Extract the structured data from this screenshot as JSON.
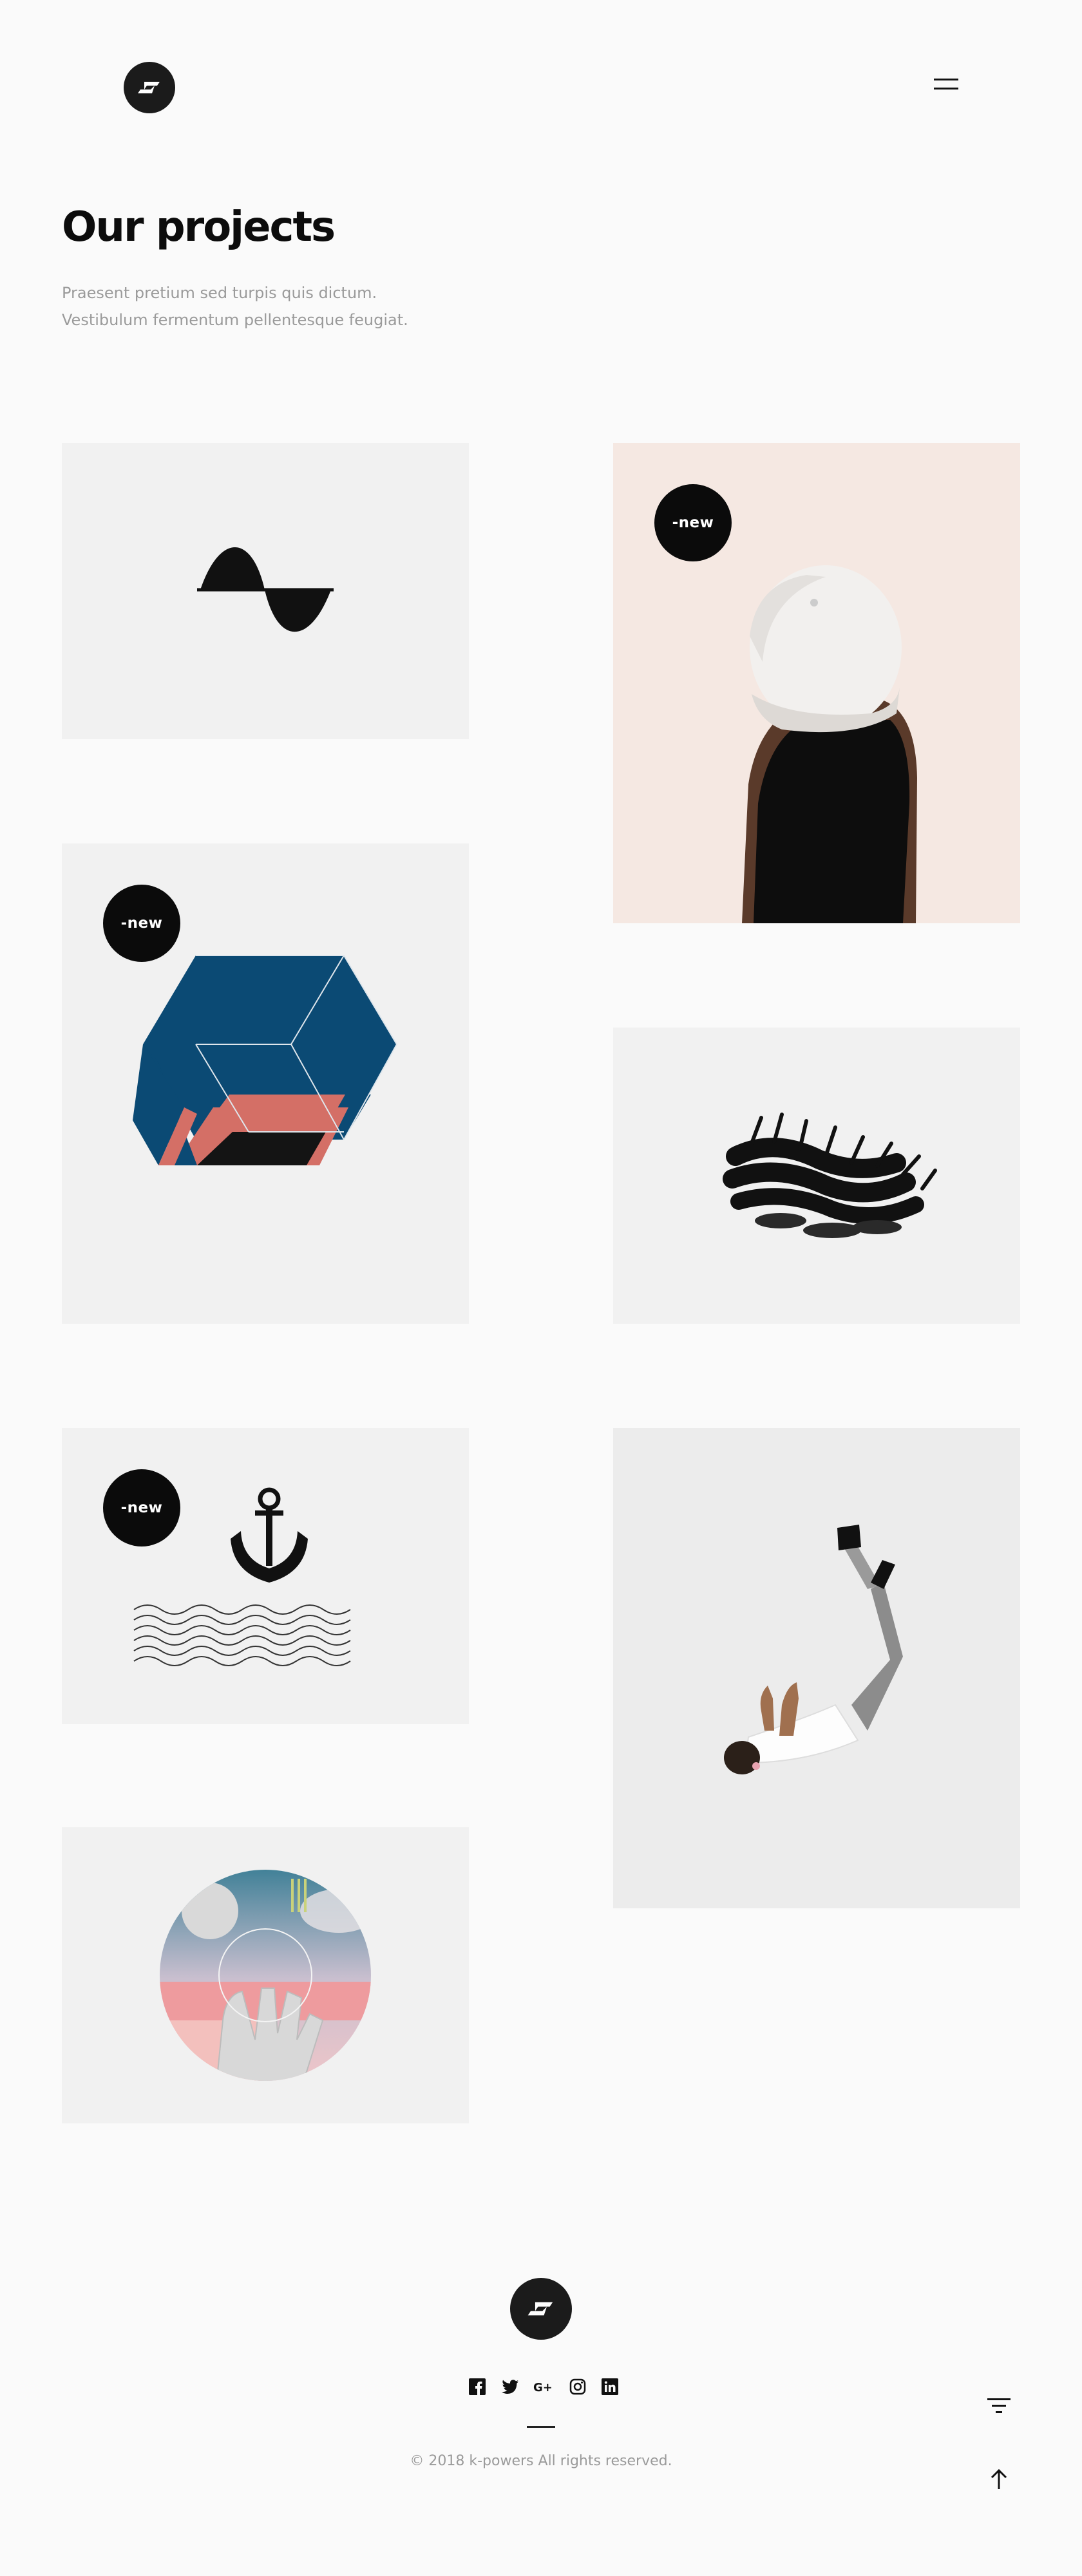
{
  "header": {
    "logo_icon": "s-logo-icon",
    "menu_icon": "hamburger-icon"
  },
  "page": {
    "title": "Our projects",
    "intro_line_1": "Praesent pretium sed turpis quis dictum.",
    "intro_line_2": "Vestibulum fermentum pellentesque feugiat."
  },
  "projects": [
    {
      "image": "sine-wave-illustration",
      "badge": ""
    },
    {
      "image": "helmet-portrait-photo",
      "badge": "-new"
    },
    {
      "image": "geometric-hexagon-illustration",
      "badge": "-new"
    },
    {
      "image": "black-paint-stroke-illustration",
      "badge": ""
    },
    {
      "image": "anchor-waves-illustration",
      "badge": "-new"
    },
    {
      "image": "falling-man-photo",
      "badge": ""
    },
    {
      "image": "hand-collage-illustration",
      "badge": ""
    }
  ],
  "footer": {
    "logo_icon": "s-logo-icon",
    "social": [
      "facebook-icon",
      "twitter-icon",
      "google-plus-icon",
      "instagram-icon",
      "linkedin-icon"
    ],
    "copyright": "© 2018 k-powers All rights reserved.",
    "filter_icon": "filter-icon",
    "scroll_top_icon": "arrow-up-icon"
  },
  "colors": {
    "background": "#fafafa",
    "card": "#f1f1f1",
    "badge": "#0b0b0b",
    "accent_blue": "#0b4a74",
    "accent_coral": "#d46f66"
  }
}
